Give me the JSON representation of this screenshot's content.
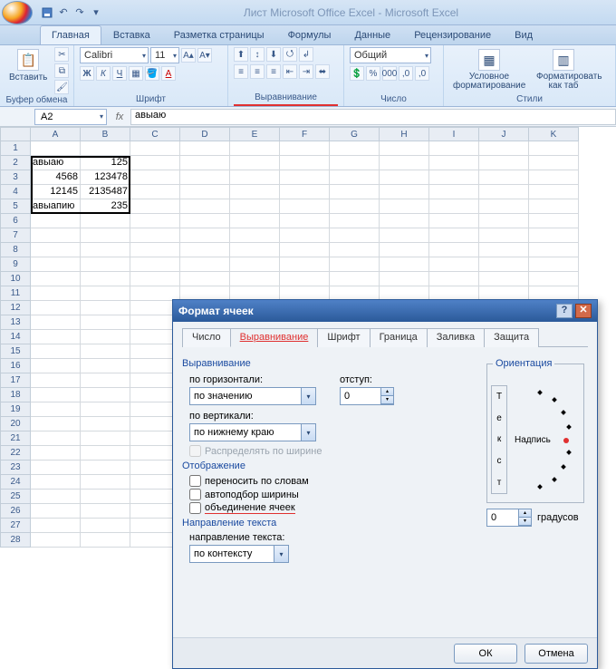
{
  "app_title": "Лист Microsoft Office Excel - Microsoft Excel",
  "ribbon_tabs": [
    "Главная",
    "Вставка",
    "Разметка страницы",
    "Формулы",
    "Данные",
    "Рецензирование",
    "Вид"
  ],
  "groups": {
    "clipboard": {
      "label": "Буфер обмена",
      "paste": "Вставить"
    },
    "font": {
      "label": "Шрифт",
      "name": "Calibri",
      "size": "11"
    },
    "align": {
      "label": "Выравнивание"
    },
    "number": {
      "label": "Число",
      "format": "Общий"
    },
    "styles": {
      "label": "Стили",
      "cond": "Условное форматирование",
      "table": "Форматировать как таб"
    }
  },
  "namebox": "A2",
  "formula": "авыаю",
  "columns": [
    "A",
    "B",
    "C",
    "D",
    "E",
    "F",
    "G",
    "H",
    "I",
    "J",
    "K"
  ],
  "rows": 28,
  "data": [
    [
      "авыаю",
      "125"
    ],
    [
      "4568",
      "123478"
    ],
    [
      "12145",
      "2135487"
    ],
    [
      "авыапию",
      "235"
    ]
  ],
  "dialog": {
    "title": "Формат ячеек",
    "tabs": [
      "Число",
      "Выравнивание",
      "Шрифт",
      "Граница",
      "Заливка",
      "Защита"
    ],
    "sec_align": "Выравнивание",
    "h_label": "по горизонтали:",
    "h_value": "по значению",
    "indent_label": "отступ:",
    "indent_value": "0",
    "v_label": "по вертикали:",
    "v_value": "по нижнему краю",
    "dist": "Распределять по ширине",
    "sec_display": "Отображение",
    "wrap": "переносить по словам",
    "shrink": "автоподбор ширины",
    "merge": "объединение ячеек",
    "sec_dir": "Направление текста",
    "dir_label": "направление текста:",
    "dir_value": "по контексту",
    "orient": "Ориентация",
    "orient_vert": "Текст",
    "orient_h": "Надпись",
    "deg_value": "0",
    "deg_label": "градусов",
    "ok": "ОК",
    "cancel": "Отмена"
  }
}
